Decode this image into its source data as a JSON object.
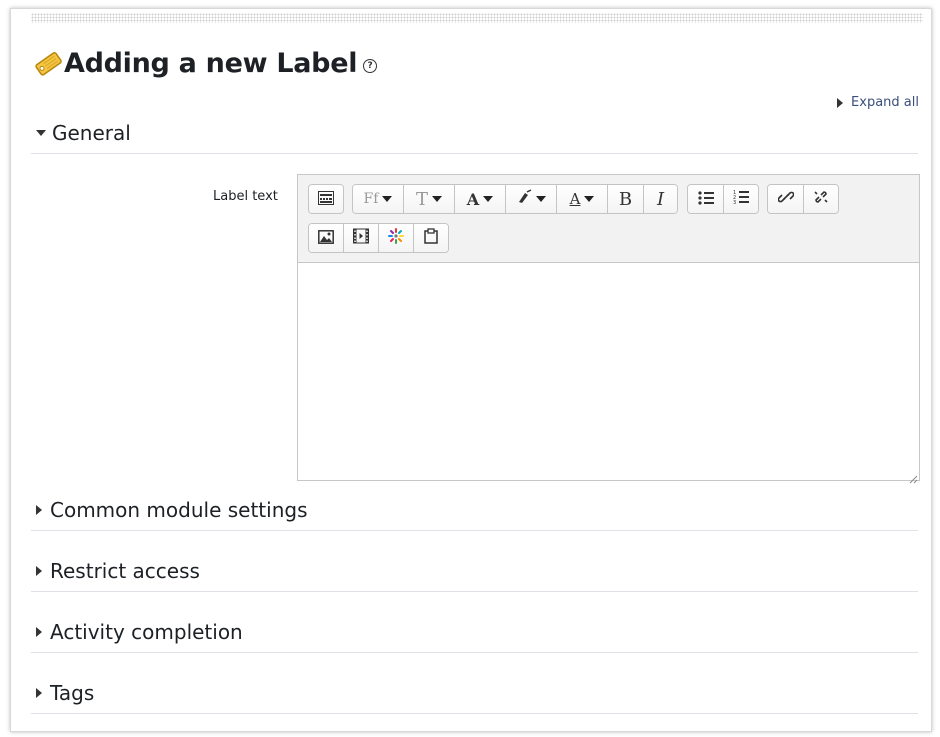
{
  "page": {
    "title": "Adding a new Label",
    "help_symbol": "?",
    "expand_all": "Expand all"
  },
  "sections": {
    "general": "General",
    "common_module_settings": "Common module settings",
    "restrict_access": "Restrict access",
    "activity_completion": "Activity completion",
    "tags": "Tags"
  },
  "form": {
    "label_text": "Label text",
    "editor_content": ""
  },
  "toolbar": {
    "row1": [
      "toolbar-toggle-icon",
      "font-family-icon",
      "font-size-icon",
      "font-color-icon",
      "background-color-icon",
      "font-style-icon",
      "bold-icon",
      "italic-icon",
      "unordered-list-icon",
      "ordered-list-icon",
      "link-icon",
      "unlink-icon"
    ],
    "row2": [
      "image-icon",
      "media-icon",
      "recordrtc-icon",
      "paste-icon"
    ],
    "labels": {
      "font_family": "Ff",
      "font_size": "T",
      "font_color": "A",
      "style": "A",
      "bold": "B",
      "italic": "I"
    }
  }
}
